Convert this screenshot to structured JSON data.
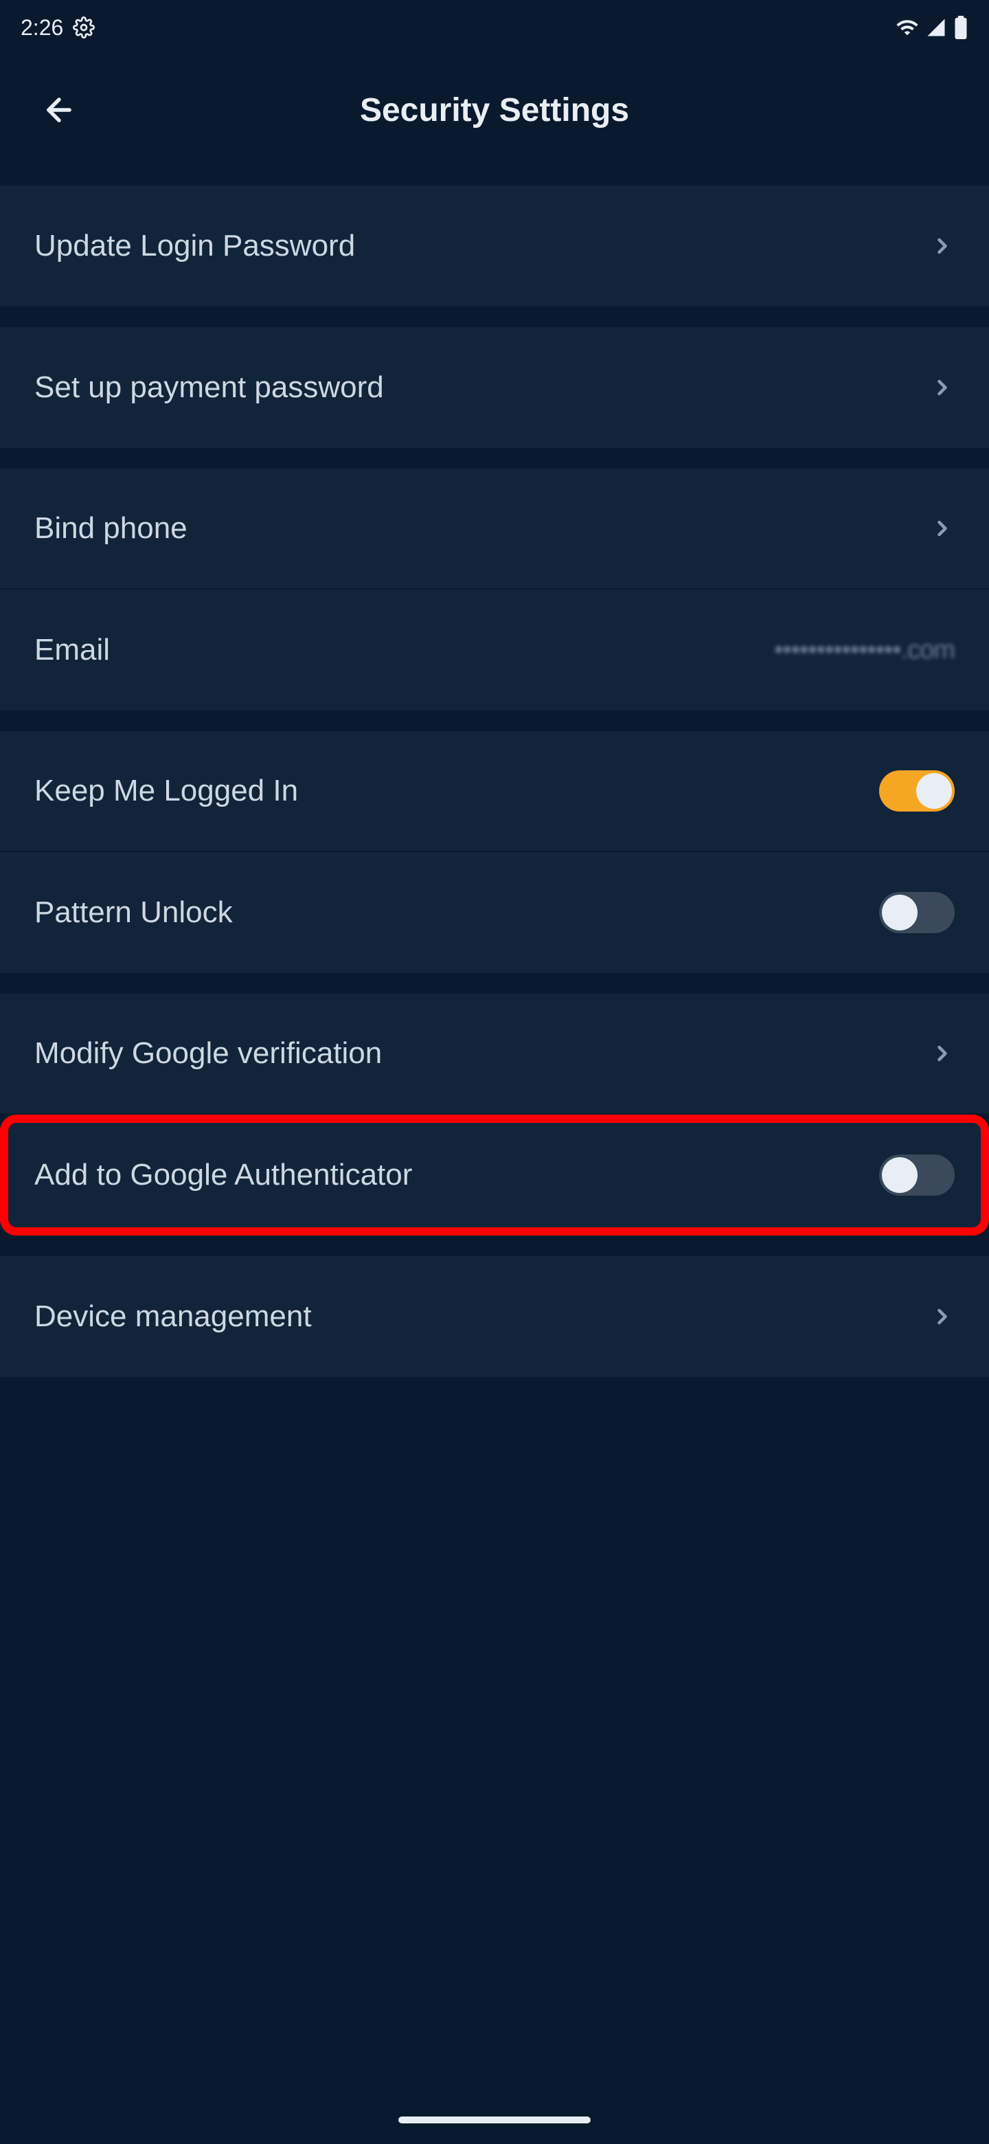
{
  "status": {
    "time": "2:26",
    "icons": {
      "gear": "gear-icon",
      "wifi": "wifi-icon",
      "signal": "signal-icon",
      "battery": "battery-icon"
    }
  },
  "header": {
    "title": "Security Settings"
  },
  "groups": [
    {
      "rows": [
        {
          "id": "update-login-password",
          "label": "Update Login Password",
          "type": "nav"
        }
      ]
    },
    {
      "rows": [
        {
          "id": "setup-payment-password",
          "label": "Set up payment password",
          "type": "nav"
        }
      ]
    },
    {
      "rows": [
        {
          "id": "bind-phone",
          "label": "Bind phone",
          "type": "nav"
        },
        {
          "id": "email",
          "label": "Email",
          "type": "value",
          "value": "•••••••••••••••.com"
        }
      ]
    },
    {
      "rows": [
        {
          "id": "keep-logged-in",
          "label": "Keep Me Logged In",
          "type": "toggle",
          "on": true
        },
        {
          "id": "pattern-unlock",
          "label": "Pattern Unlock",
          "type": "toggle",
          "on": false
        }
      ]
    },
    {
      "rows": [
        {
          "id": "modify-google-verification",
          "label": "Modify Google verification",
          "type": "nav"
        },
        {
          "id": "add-google-authenticator",
          "label": "Add to Google Authenticator",
          "type": "toggle",
          "on": false,
          "highlighted": true
        }
      ]
    },
    {
      "rows": [
        {
          "id": "device-management",
          "label": "Device management",
          "type": "nav"
        }
      ]
    }
  ]
}
